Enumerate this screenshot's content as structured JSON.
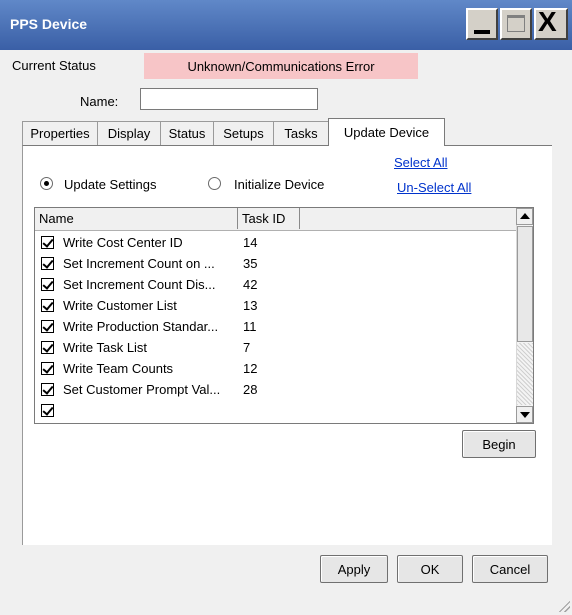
{
  "window": {
    "title": "PPS Device",
    "controls": {
      "minimize": "minimize",
      "maximize": "maximize",
      "close": "X"
    }
  },
  "status": {
    "label": "Current Status",
    "value": "Unknown/Communications Error",
    "value_bg": "#f7c5c7"
  },
  "name_field": {
    "label": "Name:",
    "value": ""
  },
  "tabs": [
    {
      "label": "Properties",
      "active": false
    },
    {
      "label": "Display",
      "active": false
    },
    {
      "label": "Status",
      "active": false
    },
    {
      "label": "Setups",
      "active": false
    },
    {
      "label": "Tasks",
      "active": false
    },
    {
      "label": "Update Device",
      "active": true
    }
  ],
  "update_device": {
    "select_all": "Select All",
    "unselect_all": "Un-Select All",
    "radio_update": {
      "label": "Update Settings",
      "selected": true
    },
    "radio_init": {
      "label": "Initialize Device",
      "selected": false
    },
    "list": {
      "columns": [
        "Name",
        "Task ID"
      ],
      "rows": [
        {
          "name": "Write Cost Center ID",
          "task_id": "14",
          "checked": true
        },
        {
          "name": "Set Increment Count on ...",
          "task_id": "35",
          "checked": true
        },
        {
          "name": "Set Increment Count Dis...",
          "task_id": "42",
          "checked": true
        },
        {
          "name": "Write Customer List",
          "task_id": "13",
          "checked": true
        },
        {
          "name": "Write Production Standar...",
          "task_id": "11",
          "checked": true
        },
        {
          "name": "Write Task List",
          "task_id": "7",
          "checked": true
        },
        {
          "name": "Write Team Counts",
          "task_id": "12",
          "checked": true
        },
        {
          "name": "Set Customer Prompt Val...",
          "task_id": "28",
          "checked": true
        }
      ]
    },
    "begin": "Begin"
  },
  "footer": {
    "apply": "Apply",
    "ok": "OK",
    "cancel": "Cancel"
  }
}
